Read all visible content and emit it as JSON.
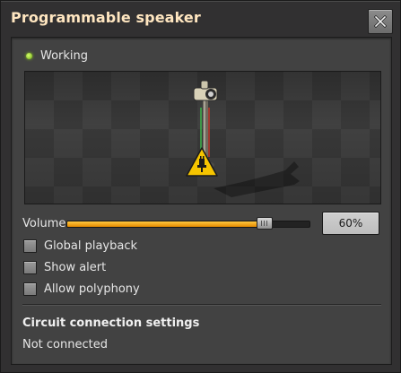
{
  "window": {
    "title": "Programmable speaker",
    "close_icon": "close-icon"
  },
  "status": {
    "text": "Working",
    "indicator_color": "#8fd21a"
  },
  "preview": {
    "entity": "programmable-speaker",
    "warning_icon": "no-power-warning-icon"
  },
  "volume": {
    "label": "Volume",
    "value_text": "60%",
    "level_fraction": 0.6,
    "accent_color": "#f5a50a"
  },
  "options": [
    {
      "label": "Global playback",
      "checked": false
    },
    {
      "label": "Show alert",
      "checked": false
    },
    {
      "label": "Allow polyphony",
      "checked": false
    }
  ],
  "circuit": {
    "title": "Circuit connection settings",
    "status": "Not connected"
  }
}
